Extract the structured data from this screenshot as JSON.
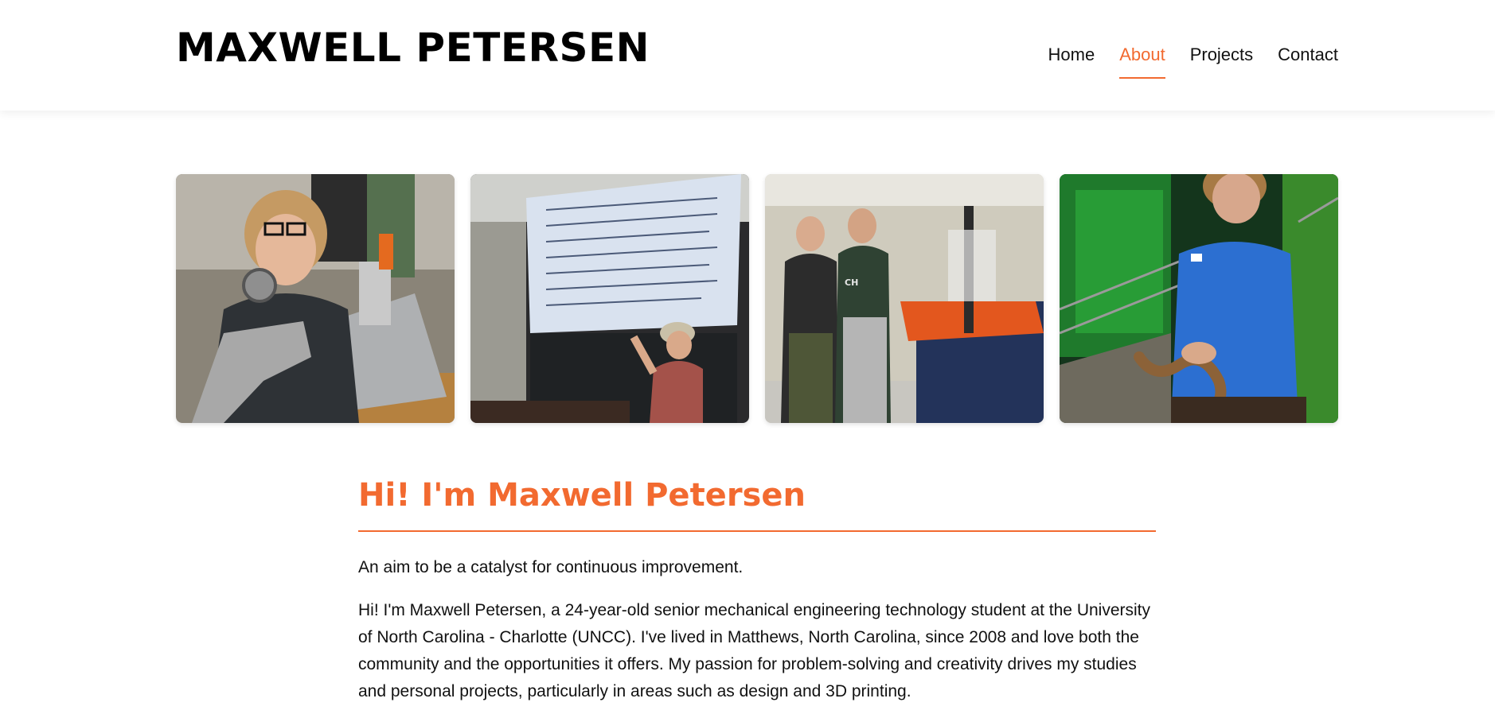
{
  "header": {
    "title": "MAXWELL PETERSEN",
    "nav": [
      {
        "label": "Home",
        "active": false
      },
      {
        "label": "About",
        "active": true
      },
      {
        "label": "Projects",
        "active": false
      },
      {
        "label": "Contact",
        "active": false
      }
    ]
  },
  "gallery": {
    "photos": [
      {
        "subject": "student holding a gear in a machine shop"
      },
      {
        "subject": "student presenting equations on a lecture screen"
      },
      {
        "subject": "two students giving thumbs up in an engineering lab"
      },
      {
        "subject": "student holding a snake at a nature center"
      }
    ]
  },
  "about": {
    "heading": "Hi! I'm Maxwell Petersen",
    "tagline": "An aim to be a catalyst for continuous improvement.",
    "bio": "Hi! I'm Maxwell Petersen, a 24-year-old senior mechanical engineering technology student at the University of North Carolina - Charlotte (UNCC). I've lived in Matthews, North Carolina, since 2008 and love both the community and the opportunities it offers. My passion for problem-solving and creativity drives my studies and personal projects, particularly in areas such as design and 3D printing."
  },
  "colors": {
    "accent": "#f26a30",
    "text": "#111111",
    "background": "#ffffff"
  }
}
